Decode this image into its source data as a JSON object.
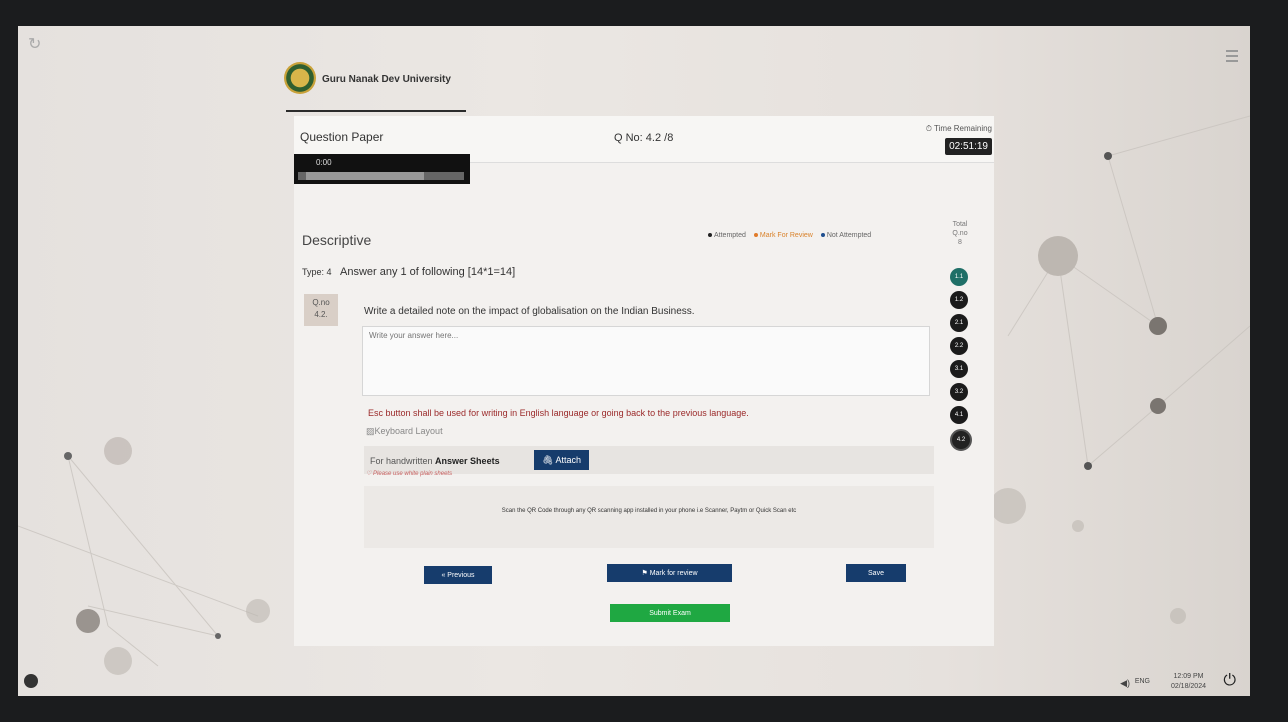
{
  "header": {
    "university": "Guru Nanak Dev University"
  },
  "topbar": {
    "title": "Question Paper",
    "qno_label": "Q No: 4.2 /8",
    "time_label": "Time Remaining",
    "timer": "02:51:19"
  },
  "audio": {
    "time": "0:00"
  },
  "section": {
    "title": "Descriptive"
  },
  "legend": [
    {
      "label": "Attempted",
      "color": "#222222"
    },
    {
      "label": "Mark For Review",
      "color": "#e07b2a"
    },
    {
      "label": "Not Attempted",
      "color": "#1f4f8f"
    }
  ],
  "total": {
    "l1": "Total",
    "l2": "Q.no",
    "l3": "8"
  },
  "question": {
    "type": "Type: 4",
    "instruction": "Answer any 1 of following [14*1=14]",
    "badge_l1": "Q.no",
    "badge_l2": "4.2.",
    "text": "Write a detailed note on the impact of globalisation on the Indian Business.",
    "answer_placeholder": "Write your answer here..."
  },
  "notes": {
    "esc": "Esc button shall be used for writing in English language or going back to the previous language.",
    "kb": "Keyboard Layout",
    "hw_prefix": "For handwritten",
    "hw_bold": "Answer Sheets",
    "attach": "Attach",
    "white": "Please use white plain sheets",
    "scan": "Scan the QR Code through any QR scanning app installed in your phone i.e Scanner, Paytm or Quick Scan etc"
  },
  "buttons": {
    "previous": "« Previous",
    "mark": "Mark for review",
    "save": "Save",
    "submit": "Submit Exam"
  },
  "qnav": [
    {
      "label": "1.1",
      "state": "current"
    },
    {
      "label": "1.2",
      "state": "default"
    },
    {
      "label": "2.1",
      "state": "default"
    },
    {
      "label": "2.2",
      "state": "default"
    },
    {
      "label": "3.1",
      "state": "default"
    },
    {
      "label": "3.2",
      "state": "default"
    },
    {
      "label": "4.1",
      "state": "default"
    },
    {
      "label": "4.2",
      "state": "attempted"
    }
  ],
  "taskbar": {
    "lang": "ENG",
    "time": "12:09 PM",
    "date": "02/18/2024"
  }
}
